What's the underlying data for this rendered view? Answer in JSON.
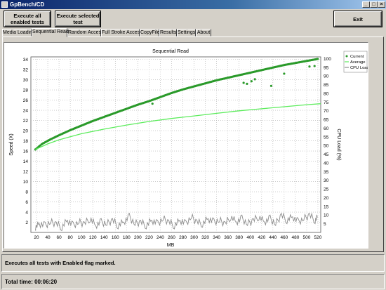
{
  "window": {
    "title": "GpBench/CD"
  },
  "toolbar": {
    "execute_all_label": "Execute all enabled tests",
    "execute_selected_label": "Execute selected test",
    "exit_label": "Exit"
  },
  "tabs": [
    {
      "label": "Media Loading",
      "active": false
    },
    {
      "label": "Sequential Read",
      "active": true
    },
    {
      "label": "Random Access",
      "active": false
    },
    {
      "label": "Full Stroke Access",
      "active": false
    },
    {
      "label": "CopyFile",
      "active": false
    },
    {
      "label": "Results",
      "active": false
    },
    {
      "label": "Settings",
      "active": false
    },
    {
      "label": "About",
      "active": false
    }
  ],
  "status": {
    "message": "Executes all tests with Enabled flag marked.",
    "total_time": "Total time:  00:06:20"
  },
  "chart_data": {
    "type": "scatter",
    "title": "Sequential Read",
    "xlabel": "MB",
    "ylabel": "Speed (X)",
    "y2label": "CPU Load (%)",
    "xlim": [
      10,
      525
    ],
    "ylim": [
      0,
      34.5
    ],
    "y2lim": [
      0,
      101
    ],
    "xticks": [
      20,
      40,
      60,
      80,
      100,
      120,
      140,
      160,
      180,
      200,
      220,
      240,
      260,
      280,
      300,
      320,
      340,
      360,
      380,
      400,
      420,
      440,
      460,
      480,
      500,
      520
    ],
    "yticks": [
      2,
      4,
      6,
      8,
      10,
      12,
      14,
      16,
      18,
      20,
      22,
      24,
      26,
      28,
      30,
      32,
      34
    ],
    "y2ticks": [
      5,
      10,
      15,
      20,
      25,
      30,
      35,
      40,
      45,
      50,
      55,
      60,
      65,
      70,
      75,
      80,
      85,
      90,
      95,
      100
    ],
    "grid": true,
    "legend_position": "top-right",
    "colors": {
      "current": "#2a9a2a",
      "average": "#5cec5c",
      "cpu": "#8c8c8c"
    },
    "series": [
      {
        "name": "Current",
        "axis": "left",
        "style": "markers",
        "x": [
          18,
          30,
          45,
          60,
          80,
          100,
          120,
          140,
          160,
          180,
          200,
          220,
          240,
          260,
          280,
          300,
          320,
          340,
          360,
          380,
          400,
          420,
          440,
          460,
          480,
          500,
          520
        ],
        "values": [
          16.3,
          17.4,
          18.3,
          19.1,
          20.1,
          21.0,
          21.9,
          22.7,
          23.5,
          24.3,
          25.1,
          25.8,
          26.6,
          27.4,
          28.1,
          28.7,
          29.3,
          29.9,
          30.4,
          30.9,
          31.4,
          31.9,
          32.4,
          32.9,
          33.3,
          33.7,
          34.1
        ]
      },
      {
        "name": "Average",
        "axis": "left",
        "style": "line",
        "x": [
          18,
          40,
          60,
          80,
          100,
          140,
          180,
          220,
          260,
          300,
          340,
          380,
          420,
          460,
          500,
          525
        ],
        "values": [
          16.3,
          17.4,
          18.2,
          18.8,
          19.4,
          20.3,
          21.1,
          21.8,
          22.4,
          22.9,
          23.4,
          23.9,
          24.3,
          24.7,
          25.1,
          25.3
        ]
      },
      {
        "name": "CPU Load",
        "axis": "right",
        "style": "line",
        "x": [
          18,
          25,
          35,
          45,
          55,
          65,
          75,
          85,
          95,
          105,
          115,
          125,
          135,
          145,
          155,
          165,
          175,
          185,
          195,
          205,
          215,
          225,
          235,
          245,
          255,
          265,
          275,
          285,
          295,
          305,
          315,
          325,
          335,
          345,
          355,
          365,
          375,
          385,
          395,
          405,
          415,
          425,
          435,
          445,
          455,
          465,
          475,
          485,
          495,
          505,
          515,
          520
        ],
        "values": [
          3,
          5,
          4,
          6,
          5,
          3,
          7,
          4,
          6,
          5,
          8,
          4,
          6,
          5,
          7,
          4,
          6,
          9,
          5,
          6,
          4,
          7,
          5,
          8,
          6,
          4,
          7,
          5,
          9,
          6,
          5,
          8,
          6,
          7,
          5,
          9,
          6,
          8,
          5,
          7,
          9,
          6,
          8,
          5,
          10,
          7,
          9,
          6,
          8,
          10,
          7,
          9
        ]
      }
    ],
    "outliers": [
      {
        "series": "Current",
        "x": 226,
        "y": 25.3
      },
      {
        "series": "Current",
        "x": 388,
        "y": 29.4
      },
      {
        "series": "Current",
        "x": 394,
        "y": 29.2
      },
      {
        "series": "Current",
        "x": 402,
        "y": 29.7
      },
      {
        "series": "Current",
        "x": 408,
        "y": 30.1
      },
      {
        "series": "Current",
        "x": 437,
        "y": 28.8
      },
      {
        "series": "Current",
        "x": 460,
        "y": 31.2
      },
      {
        "series": "Current",
        "x": 505,
        "y": 32.6
      },
      {
        "series": "Current",
        "x": 514,
        "y": 32.7
      }
    ]
  }
}
